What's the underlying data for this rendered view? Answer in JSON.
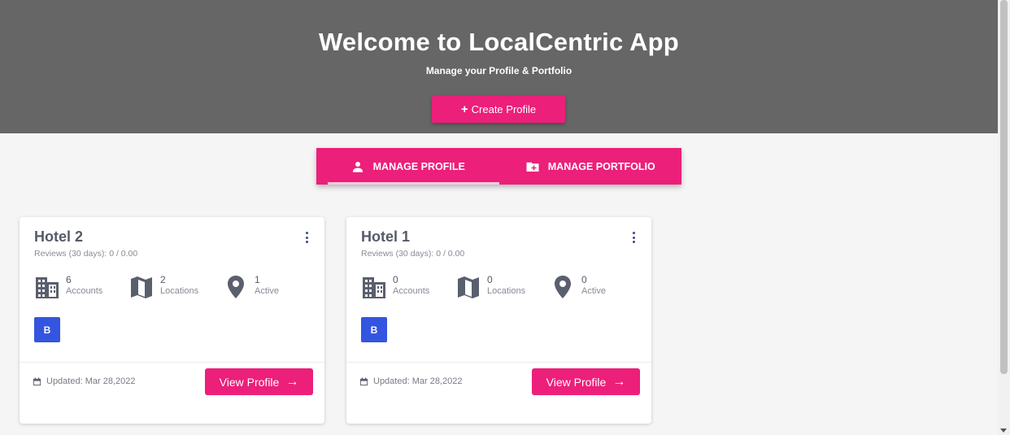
{
  "header": {
    "title": "Welcome to LocalCentric App",
    "subtitle": "Manage your Profile & Portfolio",
    "create_button": "Create Profile"
  },
  "tabs": [
    {
      "label": "MANAGE PROFILE",
      "icon": "person-icon",
      "active": true
    },
    {
      "label": "MANAGE PORTFOLIO",
      "icon": "folder-plus-icon",
      "active": false
    }
  ],
  "cards": [
    {
      "title": "Hotel 2",
      "reviews": "Reviews (30 days): 0 / 0.00",
      "stats": [
        {
          "value": "6",
          "label": "Accounts",
          "icon": "building-icon"
        },
        {
          "value": "2",
          "label": "Locations",
          "icon": "map-icon"
        },
        {
          "value": "1",
          "label": "Active",
          "icon": "location-pin-icon"
        }
      ],
      "badge": "B",
      "updated": "Updated: Mar 28,2022",
      "button": "View Profile"
    },
    {
      "title": "Hotel 1",
      "reviews": "Reviews (30 days): 0 / 0.00",
      "stats": [
        {
          "value": "0",
          "label": "Accounts",
          "icon": "building-icon"
        },
        {
          "value": "0",
          "label": "Locations",
          "icon": "map-icon"
        },
        {
          "value": "0",
          "label": "Active",
          "icon": "location-pin-icon"
        }
      ],
      "badge": "B",
      "updated": "Updated: Mar 28,2022",
      "button": "View Profile"
    }
  ],
  "colors": {
    "accent": "#ec1f7a",
    "header_bg": "#666666",
    "badge": "#3355e0"
  }
}
